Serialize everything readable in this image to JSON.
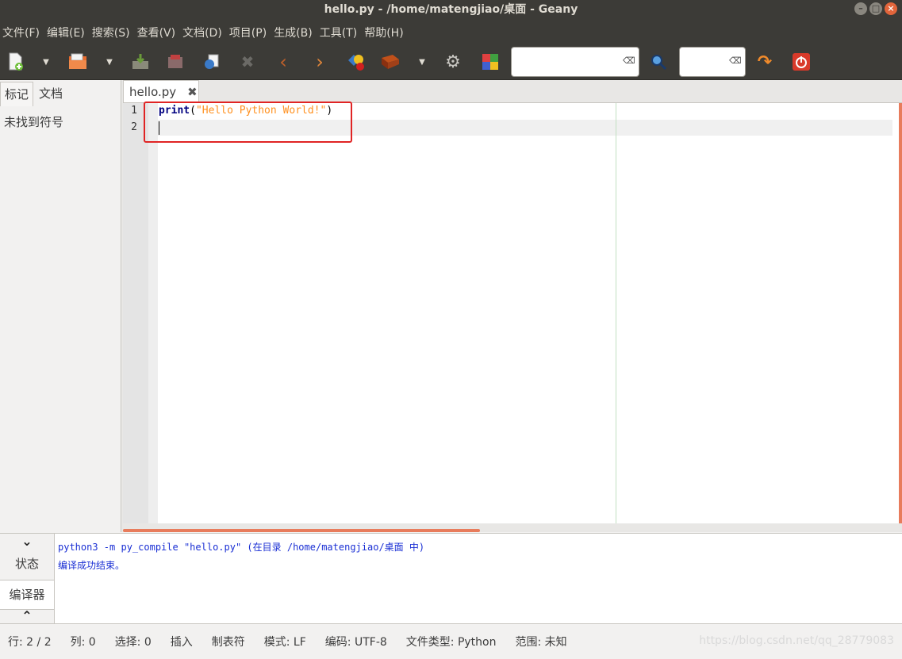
{
  "window": {
    "title": "hello.py - /home/matengjiao/桌面 - Geany"
  },
  "menu": [
    {
      "label": "文件(F)"
    },
    {
      "label": "编辑(E)"
    },
    {
      "label": "搜索(S)"
    },
    {
      "label": "查看(V)"
    },
    {
      "label": "文档(D)"
    },
    {
      "label": "项目(P)"
    },
    {
      "label": "生成(B)"
    },
    {
      "label": "工具(T)"
    },
    {
      "label": "帮助(H)"
    }
  ],
  "toolbar": {
    "search_value": "",
    "goto_value": ""
  },
  "sidebar": {
    "tabs": [
      {
        "label": "标记"
      },
      {
        "label": "文档"
      }
    ],
    "empty_message": "未找到符号"
  },
  "editor": {
    "tab_label": "hello.py",
    "lines": [
      {
        "num": "1",
        "keyword": "print",
        "open": "(",
        "string": "\"Hello Python World!\"",
        "close": ")"
      },
      {
        "num": "2"
      }
    ]
  },
  "messages": {
    "tabs": [
      {
        "label": "状态"
      },
      {
        "label": "编译器"
      }
    ],
    "lines": [
      "python3 -m py_compile \"hello.py\" (在目录 /home/matengjiao/桌面 中)",
      "编译成功结束。"
    ]
  },
  "status": {
    "line": "行: 2 / 2",
    "col": "列: 0",
    "sel": "选择: 0",
    "mode_insert": "插入",
    "indent": "制表符",
    "eol": "模式: LF",
    "encoding": "编码: UTF-8",
    "filetype": "文件类型: Python",
    "scope": "范围: 未知"
  },
  "watermark": "https://blog.csdn.net/qq_28779083"
}
